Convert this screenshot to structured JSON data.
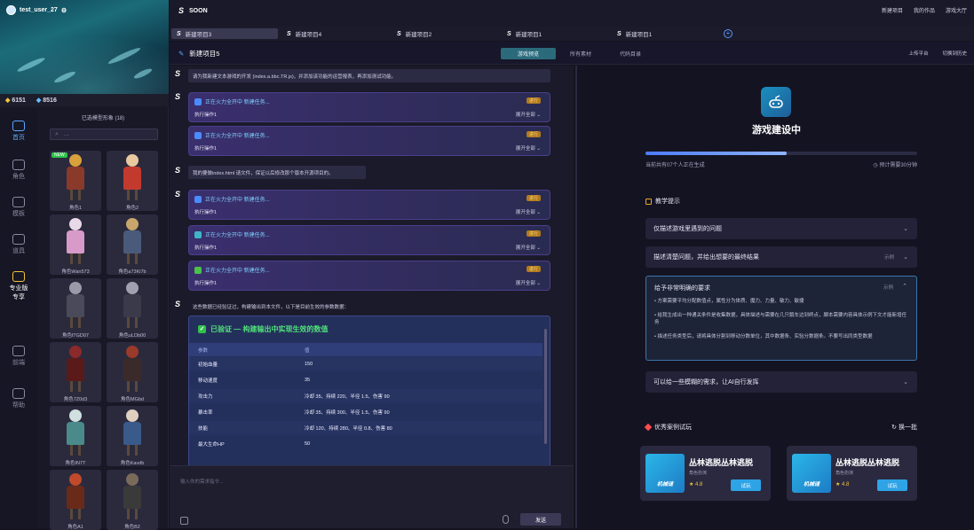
{
  "user": {
    "name": "test_user_27"
  },
  "coins": {
    "a": "6151",
    "b": "8516"
  },
  "nav": [
    {
      "label": "首页",
      "active": true
    },
    {
      "label": "角色",
      "active": false
    },
    {
      "label": "模板",
      "active": false
    },
    {
      "label": "道具",
      "active": false
    },
    {
      "label": "专业版",
      "sub": "专享",
      "active": false
    },
    {
      "label": "前端",
      "active": false
    },
    {
      "label": "帮助",
      "active": false
    }
  ],
  "gallery": {
    "title": "已选模型形象 (18)",
    "search_placeholder": "...",
    "new_tag": "NEW",
    "items": [
      {
        "name": "角色1"
      },
      {
        "name": "角色2"
      },
      {
        "name": "角色Wan573"
      },
      {
        "name": "角色a73Ki7b"
      },
      {
        "name": "角色f7GD07"
      },
      {
        "name": "角色uLDb00"
      },
      {
        "name": "角色7Z0d3"
      },
      {
        "name": "角色MGbd"
      },
      {
        "name": "角色IN7T"
      },
      {
        "name": "角色Kavdb"
      },
      {
        "name": "角色A1"
      },
      {
        "name": "角色B2"
      }
    ]
  },
  "topbar": {
    "title": "SOON",
    "links": [
      "新建项目",
      "我的作品",
      "游戏大厅"
    ]
  },
  "tabs": [
    "新建项目3",
    "新建项目4",
    "新建项目2",
    "新建项目1",
    "新建项目1"
  ],
  "subheader": {
    "title": "新建项目5",
    "segments": [
      "游戏预览",
      "所有素材",
      "代码目录"
    ],
    "right": [
      "上传平台",
      "切换到历史"
    ]
  },
  "chat": {
    "msg1": "请为我新建文本游戏的开发 (index.a.bbc.TR.js)，并添加该功能的运营报表，再添加测试功能。",
    "tasks1": [
      {
        "title": "正在火力全开中 新建任务...",
        "tag": "进行",
        "step": "执行操作1",
        "status": "展开全部"
      },
      {
        "title": "正在火力全开中 新建任务...",
        "tag": "进行",
        "step": "执行操作1",
        "status": "展开全部"
      }
    ],
    "msg2": "我的要做index.html 请文件，保证以后修改那个版本开源项目的。",
    "tasks2": [
      {
        "title": "正在火力全开中 新建任务...",
        "tag": "进行",
        "step": "执行操作1",
        "status": "展开全部"
      },
      {
        "title": "正在火力全开中 新建任务...",
        "tag": "进行",
        "step": "执行操作1",
        "status": "展开全部"
      },
      {
        "title": "正在火力全开中 新建任务...",
        "tag": "进行",
        "step": "执行操作1",
        "status": "展开全部"
      }
    ],
    "msg3": "这些数据已经验证过，构建输出到本文件，以下是目前生效的参数数据：",
    "table": {
      "heading": "已验证 — 构建输出中实现生效的数值",
      "cols": [
        "参数",
        "值"
      ],
      "rows": [
        [
          "初始血量",
          "150"
        ],
        [
          "移动速度",
          "35"
        ],
        [
          "攻击力",
          "冷却 35、持续 220、半径 1.5、伤害 90"
        ],
        [
          "暴击率",
          "冷却 35、持续 300、半径 1.5、伤害 90"
        ],
        [
          "技能",
          "冷却 120、持续 280、半径 0.8、伤害 80"
        ],
        [
          "最大生命HP",
          "50"
        ]
      ]
    },
    "input_placeholder": "输入你的需求指令...",
    "send": "发送"
  },
  "right": {
    "title": "游戏建设中",
    "progress": 0.52,
    "progress_left": "当前共有07个人正在生成",
    "progress_right": "预计需要30分钟",
    "tips_title": "教学提示",
    "acc1": "仅描述游戏里遇到的问题",
    "acc2": "描述清楚问题，并给出想要的最终结果",
    "acc2_mini": "示例",
    "acc3": "给予非常明确的要求",
    "acc3_mini": "示例",
    "bullets": [
      "方案需要平均分配数值点，属性分为体质、魔力、力量、敏力、敏捷",
      "给我生成出一种通关条件是收集数据，具体描述与需要在几只鹅车边到终点，脚本需要内容具体示例下文才能新增任务",
      "描述任务类型后，请将具体分割到移动分数单位，其中数据条、实验分数据条。不要写出同类型数据"
    ],
    "acc4": "可以给一些模糊的需求，让AI自行发挥",
    "examples_title": "优秀案例试玩",
    "swap": "换一批",
    "examples": [
      {
        "name": "丛林逃脱丛林逃脱",
        "thumb": "机械谜",
        "tag": "角色扮演",
        "rating": "★ 4.8",
        "btn": "试玩"
      },
      {
        "name": "丛林逃脱丛林逃脱",
        "thumb": "机械谜",
        "tag": "角色扮演",
        "rating": "★ 4.8",
        "btn": "试玩"
      }
    ]
  }
}
